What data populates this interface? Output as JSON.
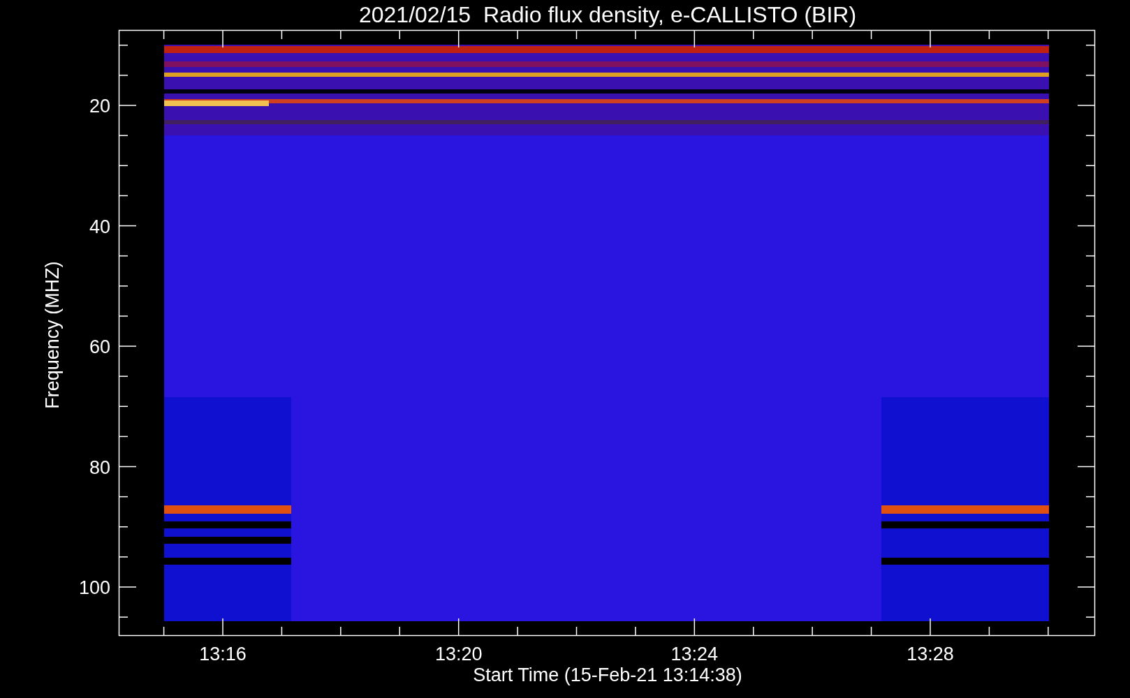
{
  "title": "2021/02/15  Radio flux density, e-CALLISTO (BIR)",
  "y_axis": {
    "label": "Frequency (MHZ)",
    "tick_labels": [
      "20",
      "40",
      "60",
      "80",
      "100"
    ]
  },
  "x_axis": {
    "label": "Start Time (15-Feb-21 13:14:38)",
    "tick_labels": [
      "13:16",
      "13:20",
      "13:24",
      "13:28"
    ]
  }
}
